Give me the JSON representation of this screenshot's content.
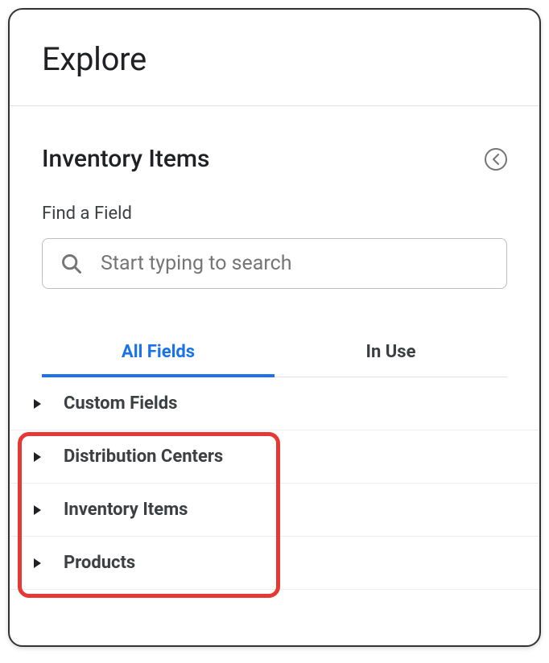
{
  "header": {
    "title": "Explore"
  },
  "section": {
    "title": "Inventory Items"
  },
  "search": {
    "label": "Find a Field",
    "placeholder": "Start typing to search"
  },
  "tabs": {
    "all_fields": "All Fields",
    "in_use": "In Use"
  },
  "fields": {
    "custom_fields": "Custom Fields",
    "distribution_centers": "Distribution Centers",
    "inventory_items": "Inventory Items",
    "products": "Products"
  }
}
